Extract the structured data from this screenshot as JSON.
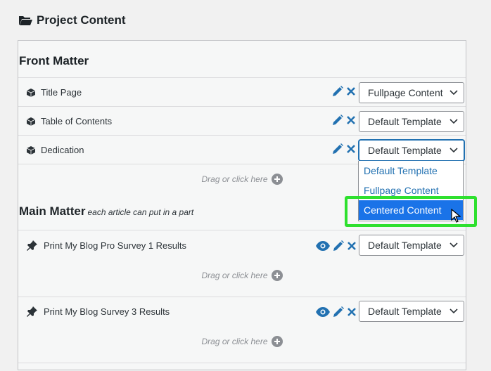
{
  "header": {
    "title": "Project Content",
    "icon": "folder-open-icon"
  },
  "front_matter": {
    "title": "Front Matter",
    "rows": [
      {
        "label": "Title Page",
        "icon": "cube-icon",
        "template": "Fullpage Content"
      },
      {
        "label": "Table of Contents",
        "icon": "cube-icon",
        "template": "Default Template"
      },
      {
        "label": "Dedication",
        "icon": "cube-icon",
        "template": "Default Template"
      }
    ],
    "drag_text": "Drag or click here"
  },
  "main_matter": {
    "title": "Main Matter",
    "subtitle": "each article can put in a part",
    "rows": [
      {
        "label": "Print My Blog Pro Survey 1 Results",
        "icon": "pin-icon",
        "template": "Default Template",
        "drag_text": "Drag or click here"
      },
      {
        "label": "Print My Blog Survey 3 Results",
        "icon": "pin-icon",
        "template": "Default Template",
        "drag_text": "Drag or click here"
      }
    ]
  },
  "dropdown": {
    "options": [
      "Default Template",
      "Fullpage Content",
      "Centered Content"
    ],
    "selected": "Centered Content"
  },
  "colors": {
    "accent": "#2271b1",
    "highlight": "#2ee02e",
    "selected_option": "#1a73e8"
  }
}
